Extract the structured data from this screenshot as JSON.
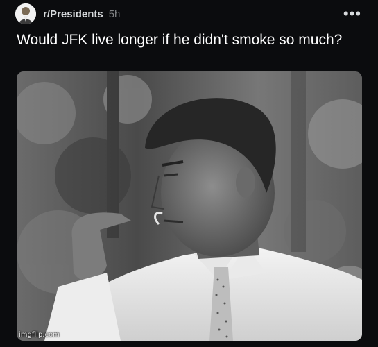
{
  "post": {
    "subreddit": "r/Presidents",
    "age": "5h",
    "more_label": "•••",
    "title": "Would JFK live longer if he didn't smoke so much?"
  },
  "image": {
    "description_icon": "photo-image",
    "watermark": "imgflip.com"
  }
}
